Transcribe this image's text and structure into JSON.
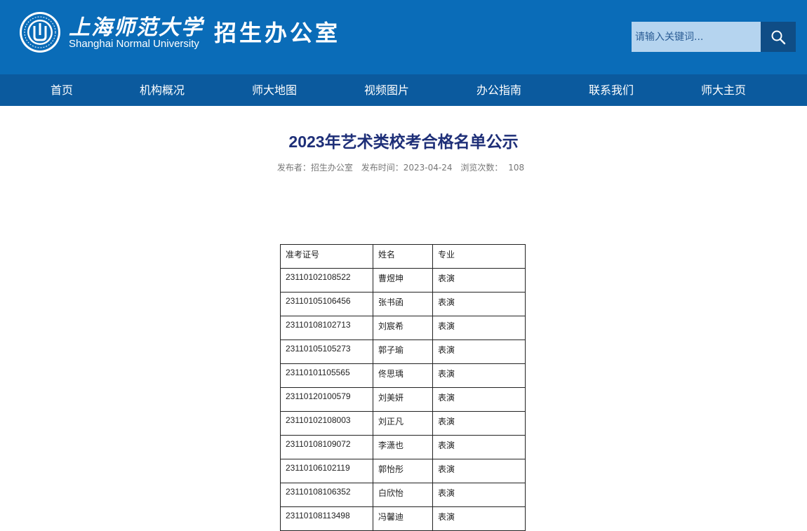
{
  "header": {
    "logo_cn": "上海师范大学",
    "logo_en": "Shanghai Normal University",
    "dept_name": "招生办公室",
    "search_placeholder": "请输入关键词...",
    "brand_color": "#0a6cb8"
  },
  "nav": {
    "items": [
      {
        "label": "首页"
      },
      {
        "label": "机构概况"
      },
      {
        "label": "师大地图"
      },
      {
        "label": "视频图片"
      },
      {
        "label": "办公指南"
      },
      {
        "label": "联系我们"
      },
      {
        "label": "师大主页"
      }
    ]
  },
  "article": {
    "title": "2023年艺术类校考合格名单公示",
    "meta": {
      "publisher_label": "发布者：",
      "publisher": "招生办公室",
      "date_label": "发布时间：",
      "date": "2023-04-24",
      "views_label": "浏览次数：",
      "views": "108"
    }
  },
  "table": {
    "headers": [
      "准考证号",
      "姓名",
      "专业"
    ],
    "rows": [
      [
        "23110102108522",
        "曹煜坤",
        "表演"
      ],
      [
        "23110105106456",
        "张书函",
        "表演"
      ],
      [
        "23110108102713",
        "刘宸希",
        "表演"
      ],
      [
        "23110105105273",
        "郭子瑜",
        "表演"
      ],
      [
        "23110101105565",
        "佟思瑀",
        "表演"
      ],
      [
        "23110120100579",
        "刘美妍",
        "表演"
      ],
      [
        "23110102108003",
        "刘正凡",
        "表演"
      ],
      [
        "23110108109072",
        "李潇也",
        "表演"
      ],
      [
        "23110106102119",
        "郭怡彤",
        "表演"
      ],
      [
        "23110108106352",
        "白欣怡",
        "表演"
      ],
      [
        "23110108113498",
        "冯馨迪",
        "表演"
      ]
    ]
  }
}
